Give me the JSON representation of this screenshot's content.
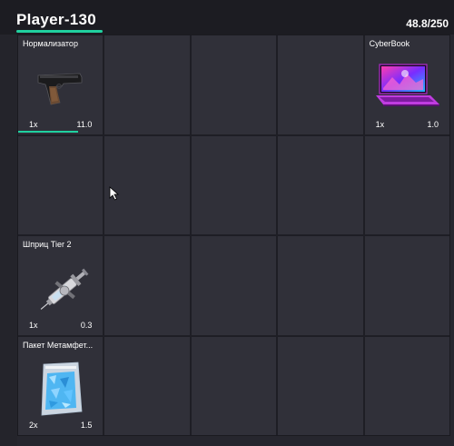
{
  "header": {
    "player_name": "Player-130",
    "weight": "48.8/250"
  },
  "inventory": {
    "columns": 5,
    "rows": 4,
    "items": [
      {
        "slot": 0,
        "name": "Нормализатор",
        "quantity": "1x",
        "weight": "11.0",
        "icon": "pistol-icon",
        "durability": 0.71
      },
      {
        "slot": 4,
        "name": "CyberBook",
        "quantity": "1x",
        "weight": "1.0",
        "icon": "laptop-icon"
      },
      {
        "slot": 10,
        "name": "Шприц Tier 2",
        "quantity": "1x",
        "weight": "0.3",
        "icon": "syringe-icon"
      },
      {
        "slot": 15,
        "name": "Пакет Метамфет...",
        "quantity": "2x",
        "weight": "1.5",
        "icon": "crystal-bag-icon"
      }
    ]
  },
  "colors": {
    "accent": "#20d1a0",
    "background": "#26262e",
    "slot": "#303039"
  }
}
